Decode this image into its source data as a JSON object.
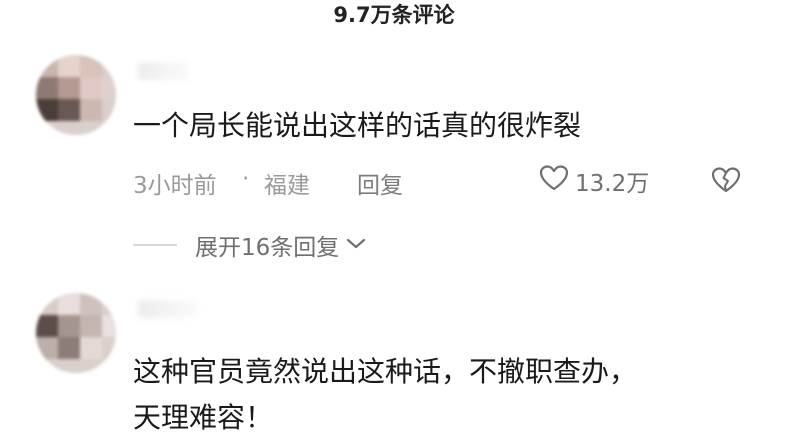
{
  "header": {
    "title": "9.7万条评论"
  },
  "comments": [
    {
      "text": "一个局长能说出这样的话真的很炸裂",
      "time": "3小时前",
      "separator": "·",
      "location": "福建",
      "reply_label": "回复",
      "likes": "13.2万",
      "expand_label": "展开16条回复"
    },
    {
      "text": "这种官员竟然说出这种话，不撤职查办，\n天理难容！"
    }
  ],
  "icons": {
    "like": "heart-outline-icon",
    "dislike": "broken-heart-icon",
    "expand": "chevron-down-icon"
  }
}
